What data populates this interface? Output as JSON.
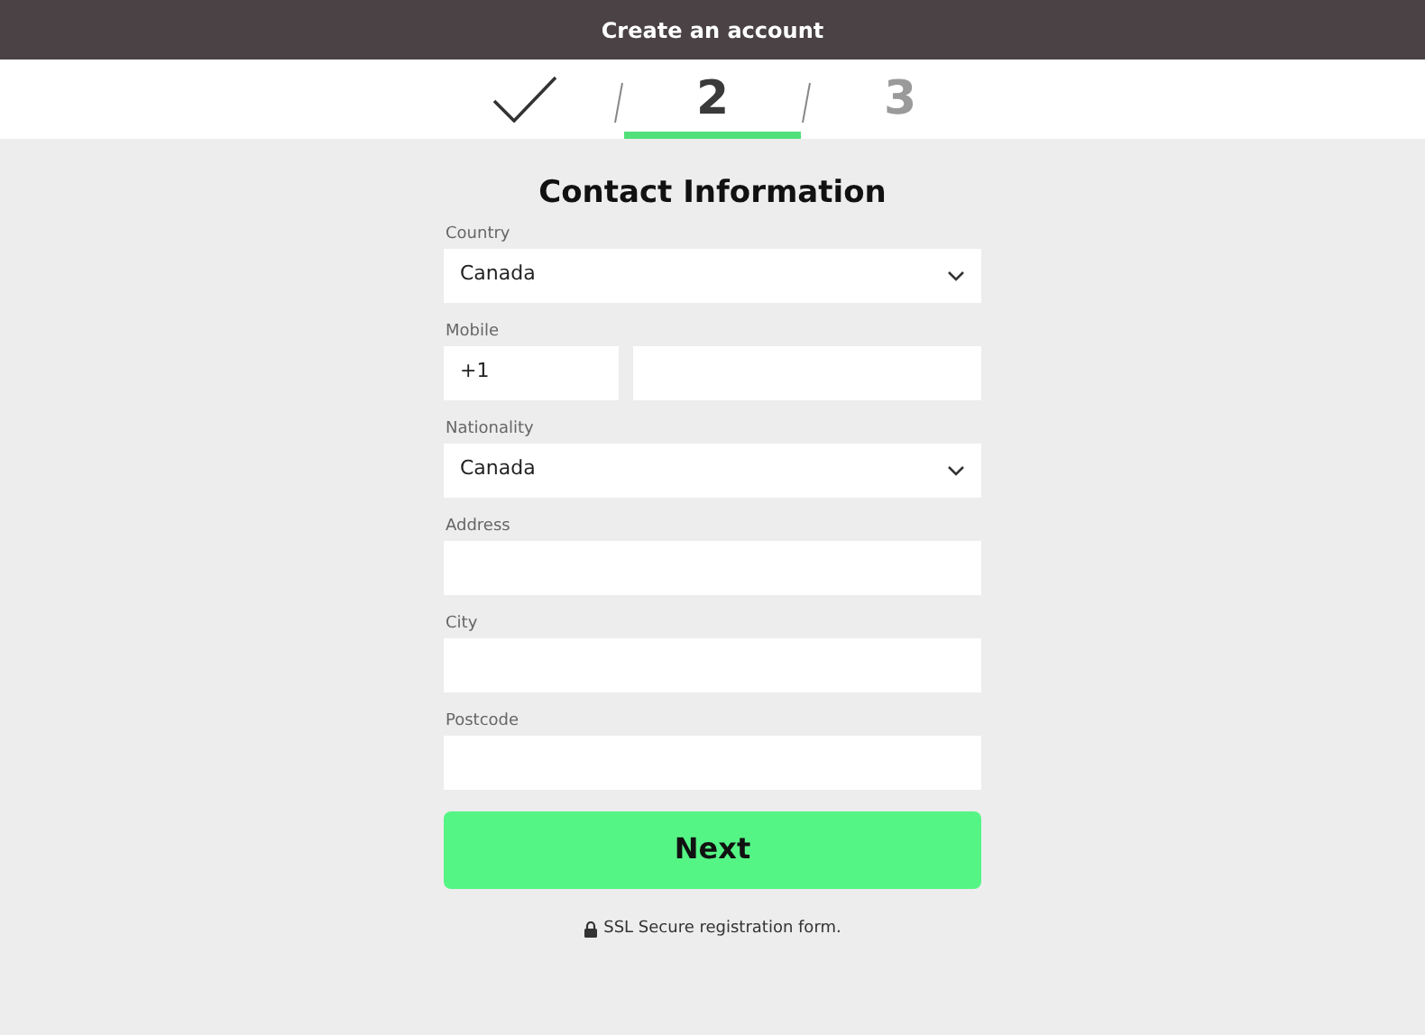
{
  "header": {
    "title": "Create an account"
  },
  "steps": [
    {
      "kind": "done",
      "selected": false
    },
    {
      "kind": "number",
      "label": "2",
      "selected": true
    },
    {
      "kind": "number",
      "label": "3",
      "selected": false
    }
  ],
  "form": {
    "title": "Contact Information",
    "fields": [
      {
        "kind": "select",
        "label": "Country",
        "value": "Canada"
      },
      {
        "kind": "phone",
        "label": "Mobile",
        "code": "+1"
      },
      {
        "kind": "select",
        "label": "Nationality",
        "value": "Canada"
      },
      {
        "kind": "text",
        "label": "Address"
      },
      {
        "kind": "text",
        "label": "City"
      },
      {
        "kind": "text",
        "label": "Postcode"
      }
    ],
    "button": "Next",
    "note": "SSL Secure registration form."
  }
}
